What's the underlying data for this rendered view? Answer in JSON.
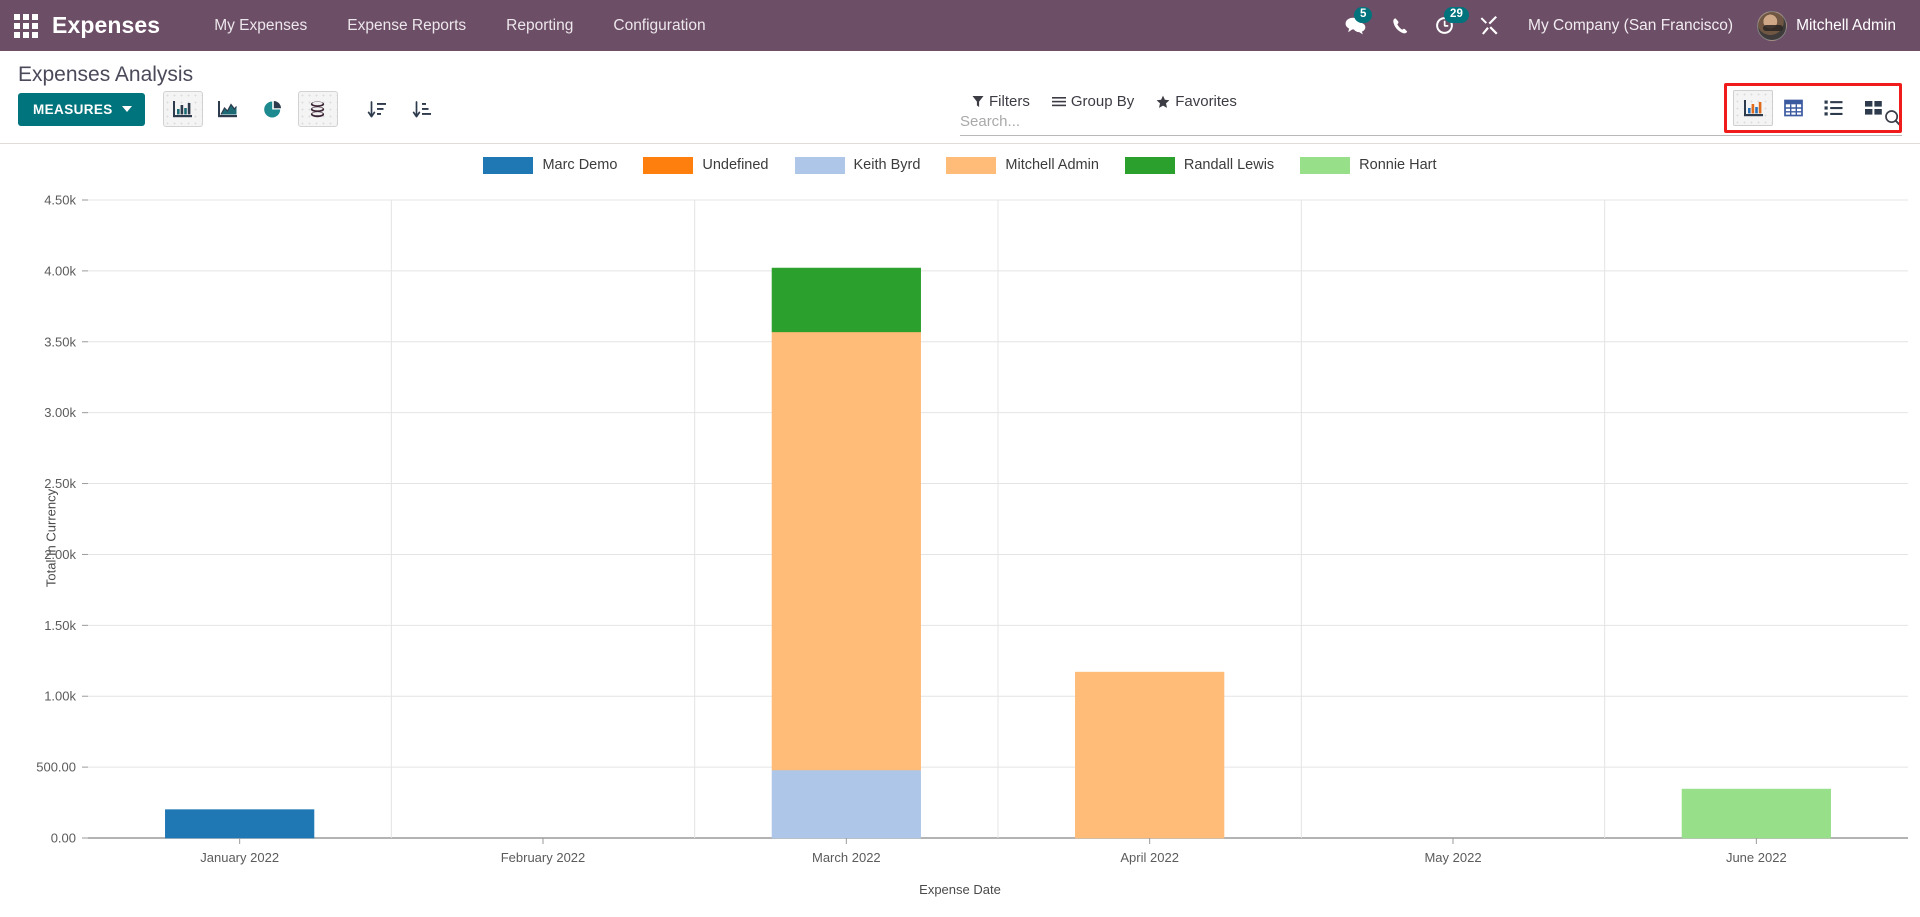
{
  "navbar": {
    "apps_icon": "apps-grid-icon",
    "brand": "Expenses",
    "menu": [
      {
        "label": "My Expenses"
      },
      {
        "label": "Expense Reports"
      },
      {
        "label": "Reporting"
      },
      {
        "label": "Configuration"
      }
    ],
    "messages_icon": "chat-bubble-icon",
    "messages_count": "5",
    "phone_icon": "phone-icon",
    "activities_icon": "clock-icon",
    "activities_count": "29",
    "tools_icon": "wrench-screwdriver-icon",
    "company": "My Company (San Francisco)",
    "avatar_icon": "user-avatar",
    "user": "Mitchell Admin"
  },
  "control_panel": {
    "title": "Expenses Analysis",
    "measures_label": "MEASURES",
    "chart_tools": [
      {
        "name": "bar-chart-icon",
        "active": true
      },
      {
        "name": "area-chart-icon",
        "active": false
      },
      {
        "name": "pie-chart-icon",
        "active": false
      },
      {
        "name": "stacked-icon",
        "active": true
      }
    ],
    "sort_tools": [
      {
        "name": "sort-descending-icon"
      },
      {
        "name": "sort-ascending-icon"
      }
    ],
    "search_placeholder": "Search...",
    "search_value": "",
    "search_icon": "magnifier-icon",
    "filters_label": "Filters",
    "group_by_label": "Group By",
    "favorites_label": "Favorites",
    "filters_icon": "funnel-icon",
    "group_by_icon": "hamburger-icon",
    "favorites_icon": "star-icon",
    "views": [
      {
        "name": "graph-view-icon",
        "active": true
      },
      {
        "name": "pivot-view-icon",
        "active": false
      },
      {
        "name": "list-view-icon",
        "active": false
      },
      {
        "name": "kanban-view-icon",
        "active": false
      }
    ],
    "highlight_color": "#f01c1c"
  },
  "chart_data": {
    "type": "bar",
    "stacked": true,
    "title": "",
    "xlabel": "Expense Date",
    "ylabel": "Total In Currency",
    "categories": [
      "January 2022",
      "February 2022",
      "March 2022",
      "April 2022",
      "May 2022",
      "June 2022"
    ],
    "ylim": [
      0,
      4500
    ],
    "ytick_values": [
      0,
      500,
      1000,
      1500,
      2000,
      2500,
      3000,
      3500,
      4000,
      4500
    ],
    "ytick_labels": [
      "0.00",
      "500.00",
      "1.00k",
      "1.50k",
      "2.00k",
      "2.50k",
      "3.00k",
      "3.50k",
      "4.00k",
      "4.50k"
    ],
    "grid": true,
    "legend_position": "top",
    "series": [
      {
        "name": "Marc Demo",
        "color": "#1f77b4",
        "values": [
          200,
          0,
          0,
          0,
          0,
          0
        ]
      },
      {
        "name": "Undefined",
        "color": "#ff7f0e",
        "values": [
          0,
          0,
          0,
          0,
          0,
          0
        ]
      },
      {
        "name": "Keith Byrd",
        "color": "#aec7e8",
        "values": [
          0,
          0,
          480,
          0,
          0,
          0
        ]
      },
      {
        "name": "Mitchell Admin",
        "color": "#ffbb78",
        "values": [
          0,
          0,
          3090,
          1170,
          0,
          0
        ]
      },
      {
        "name": "Randall Lewis",
        "color": "#2ca02c",
        "values": [
          0,
          0,
          450,
          0,
          0,
          0
        ]
      },
      {
        "name": "Ronnie Hart",
        "color": "#98df8a",
        "values": [
          0,
          0,
          0,
          0,
          0,
          345
        ]
      }
    ],
    "stack_totals": [
      200,
      0,
      4020,
      1170,
      0,
      345
    ]
  }
}
